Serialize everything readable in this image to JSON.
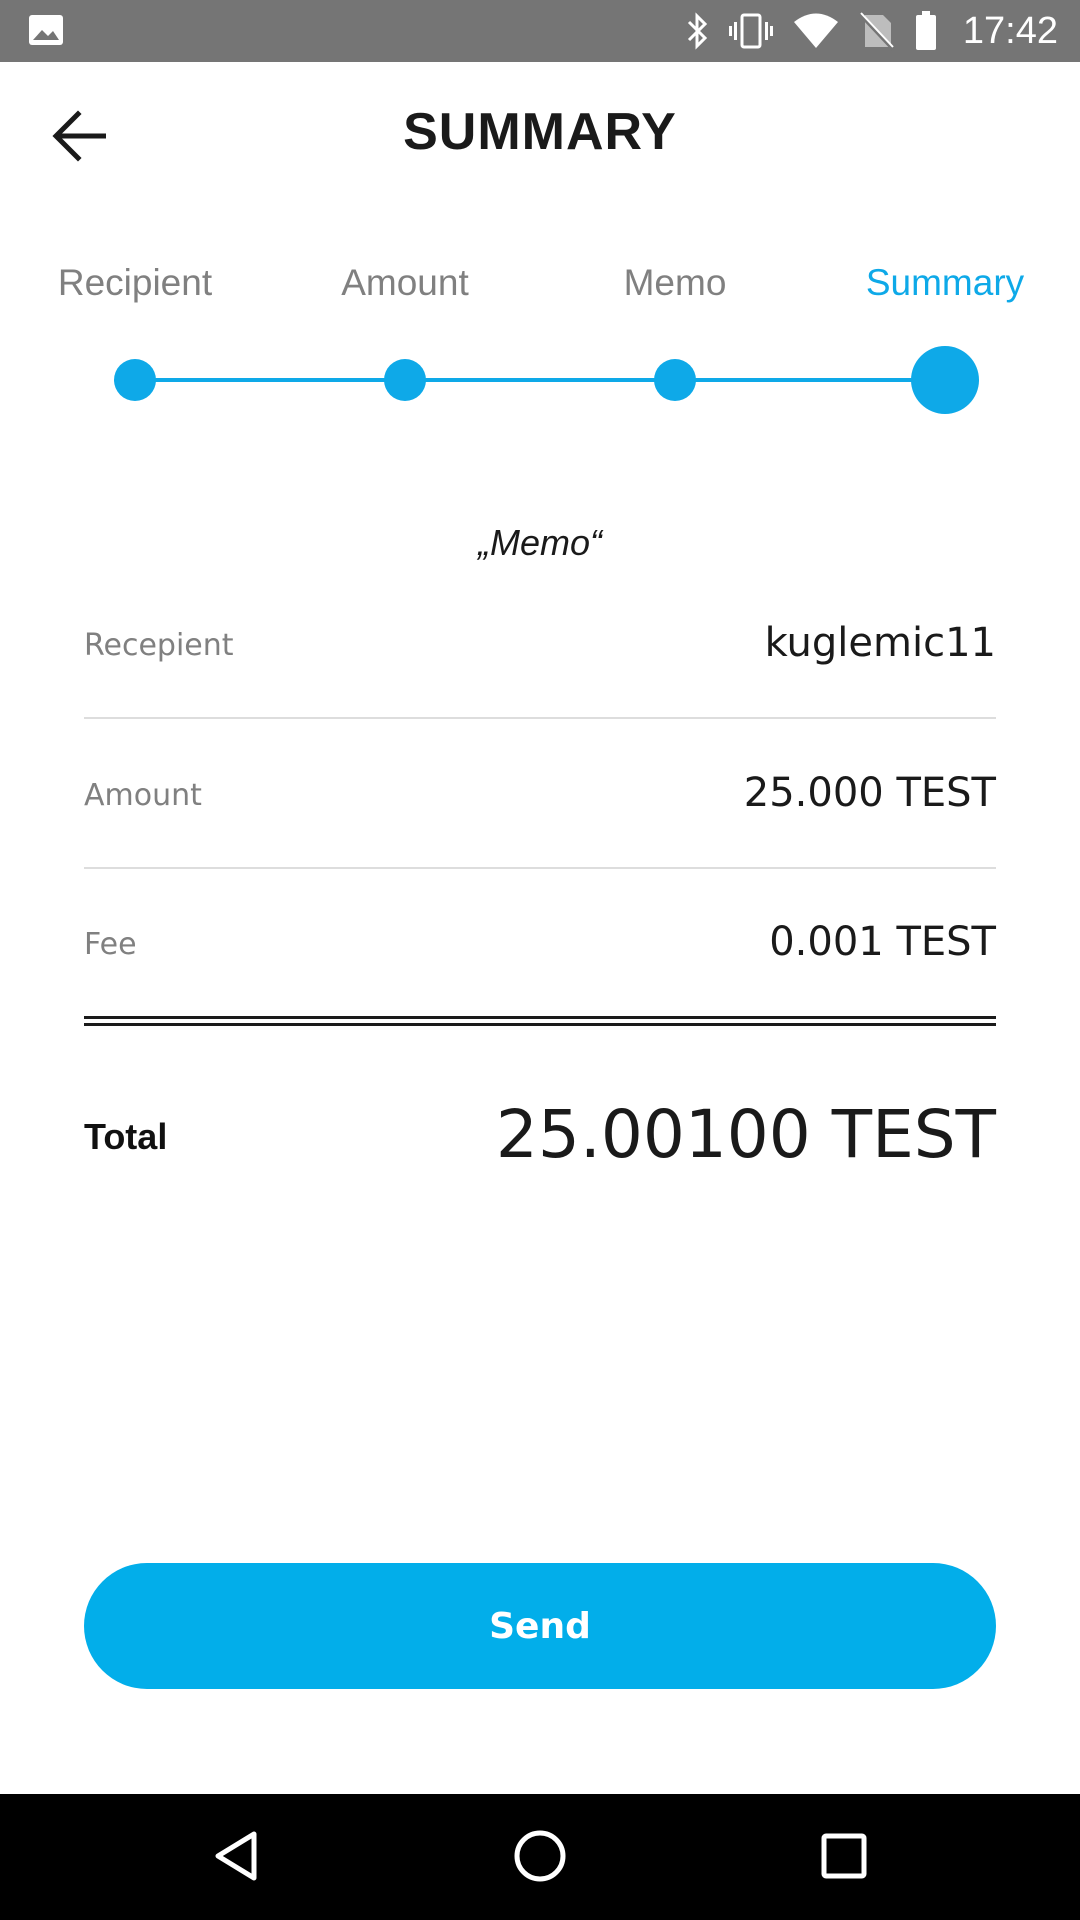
{
  "status_bar": {
    "time": "17:42",
    "icons": [
      "image-icon",
      "bluetooth-icon",
      "vibrate-icon",
      "wifi-icon",
      "no-sim-icon",
      "battery-icon"
    ]
  },
  "header": {
    "title": "SUMMARY",
    "back_icon": "arrow-left-icon"
  },
  "stepper": {
    "steps": [
      {
        "label": "Recipient",
        "active": false
      },
      {
        "label": "Amount",
        "active": false
      },
      {
        "label": "Memo",
        "active": false
      },
      {
        "label": "Summary",
        "active": true
      }
    ],
    "current_step": 4
  },
  "summary": {
    "memo": "„Memo“",
    "rows": [
      {
        "label": "Recepient",
        "value": "kuglemic11"
      },
      {
        "label": "Amount",
        "value": "25.000 TEST"
      },
      {
        "label": "Fee",
        "value": "0.001 TEST"
      }
    ],
    "total_label": "Total",
    "total_value": "25.00100 TEST"
  },
  "actions": {
    "send_label": "Send"
  },
  "nav_bar": {
    "icons": [
      "back-triangle-icon",
      "home-circle-icon",
      "recents-square-icon"
    ]
  },
  "colors": {
    "accent": "#02aeea",
    "status_bar": "#757575",
    "nav_bar": "#000000",
    "label_gray": "#808080",
    "text_dark": "#1a1a1a"
  }
}
